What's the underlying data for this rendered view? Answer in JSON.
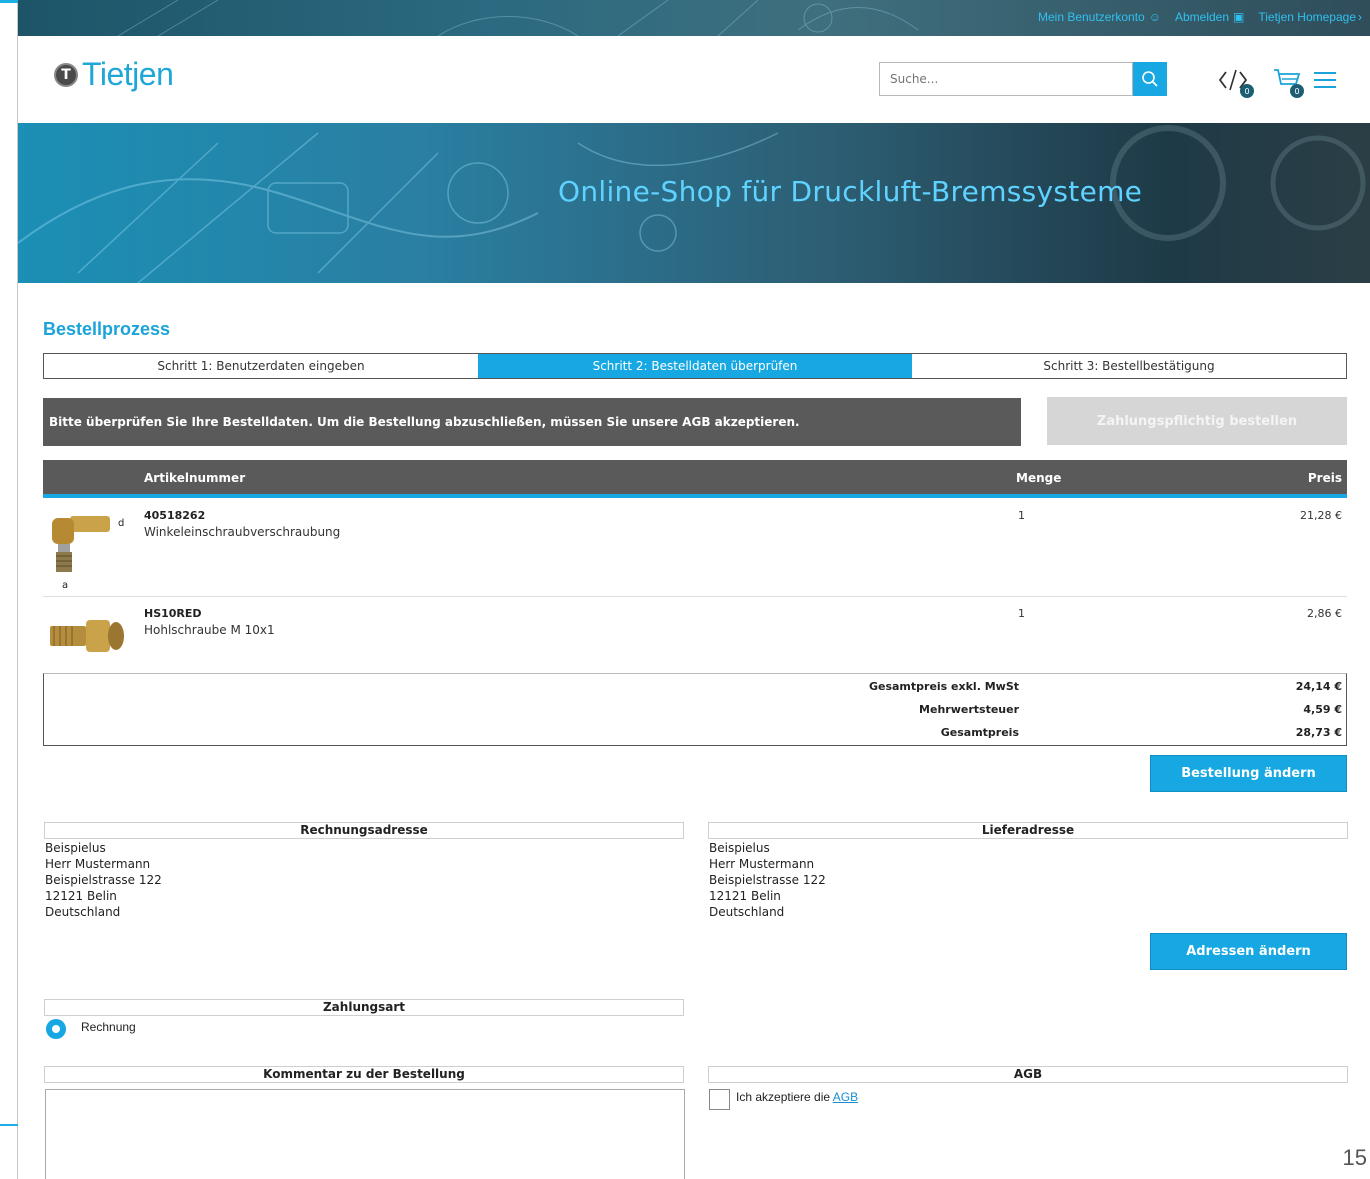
{
  "topbar": {
    "account_label": "Mein Benutzerkonto",
    "logout_label": "Abmelden",
    "homepage_label": "Tietjen Homepage"
  },
  "header": {
    "logo_text": "Tietjen",
    "search_placeholder": "Suche...",
    "compare_count": "0",
    "cart_count": "0"
  },
  "banner": {
    "title": "Online-Shop für Druckluft-Bremssysteme"
  },
  "checkout": {
    "title": "Bestellprozess",
    "steps": [
      {
        "label": "Schritt 1: Benutzerdaten eingeben"
      },
      {
        "label": "Schritt 2: Bestelldaten überprüfen"
      },
      {
        "label": "Schritt 3: Bestellbestätigung"
      }
    ],
    "active_step": 2,
    "notice": "Bitte überprüfen Sie Ihre Bestelldaten. Um die Bestellung abzuschließen, müssen Sie unsere AGB akzeptieren.",
    "order_button": "Zahlungspflichtig bestellen"
  },
  "table": {
    "headers": {
      "article": "Artikelnummer",
      "qty": "Menge",
      "price": "Preis"
    },
    "items": [
      {
        "number": "40518262",
        "description": "Winkeleinschraubverschraubung",
        "qty": "1",
        "price": "21,28 €",
        "thumb_labels": {
          "d": "d",
          "a": "a"
        }
      },
      {
        "number": "HS10RED",
        "description": "Hohlschraube M 10x1",
        "qty": "1",
        "price": "2,86 €"
      }
    ]
  },
  "totals": {
    "net_label": "Gesamtpreis exkl. MwSt",
    "net_value": "24,14 €",
    "vat_label": "Mehrwertsteuer",
    "vat_value": "4,59 €",
    "gross_label": "Gesamtpreis",
    "gross_value": "28,73 €"
  },
  "buttons": {
    "change_order": "Bestellung ändern",
    "change_address": "Adressen ändern"
  },
  "billing": {
    "title": "Rechnungsadresse",
    "lines": [
      "Beispielus",
      "Herr Mustermann",
      "Beispielstrasse 122",
      "12121 Belin",
      "Deutschland"
    ]
  },
  "shipping": {
    "title": "Lieferadresse",
    "lines": [
      "Beispielus",
      "Herr Mustermann",
      "Beispielstrasse 122",
      "12121 Belin",
      "Deutschland"
    ]
  },
  "payment": {
    "title": "Zahlungsart",
    "option": "Rechnung"
  },
  "comment": {
    "title": "Kommentar zu der Bestellung"
  },
  "terms": {
    "title": "AGB",
    "text": "Ich akzeptiere die",
    "link": "AGB"
  },
  "page_number": "15",
  "colors": {
    "accent": "#17a8e3",
    "dark_bar": "#5a5a5a",
    "disabled": "#d6d6d6"
  }
}
